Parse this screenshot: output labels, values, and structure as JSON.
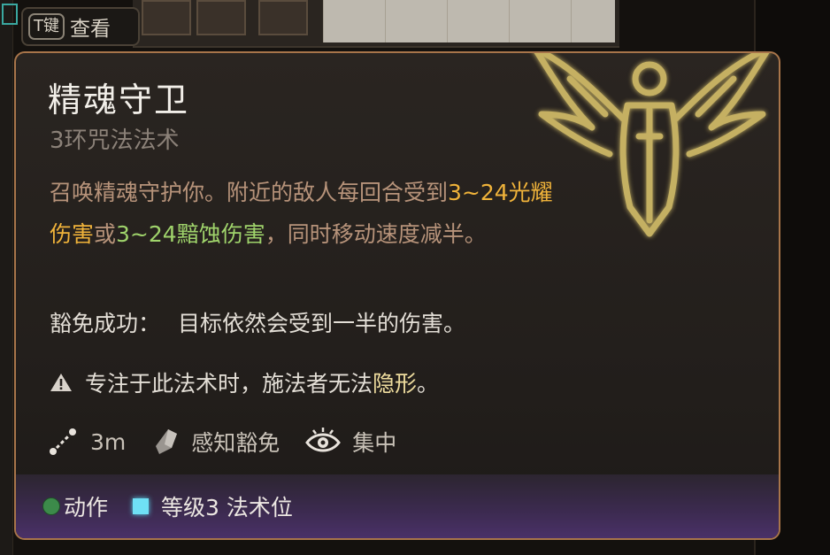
{
  "key_hint": {
    "key": "T键",
    "label": "查看"
  },
  "spell": {
    "title": "精魂守卫",
    "subtitle": "3环咒法法术",
    "description": {
      "part1": "召唤精魂守护你。附近的敌人每回合受到",
      "radiant_damage": "3~24光耀伤害",
      "conj": "或",
      "necrotic_damage": "3~24黯蚀伤害",
      "part2": "，同时移动速度",
      "halved": "减半",
      "end": "。"
    },
    "save": {
      "label": "豁免成功：",
      "text": "目标依然会受到一半的伤害。"
    },
    "concentration_warning": {
      "text": "专注于此法术时，施法者无法",
      "invisible": "隐形",
      "end": "。"
    },
    "properties": {
      "range": "3m",
      "save_type": "感知豁免",
      "concentration": "集中"
    },
    "cost": {
      "action": "动作",
      "spell_slot": "等级3 法术位"
    }
  },
  "colors": {
    "border": "#a8754a",
    "radiant": "#f0b33a",
    "necrotic": "#9fd36b",
    "emblem": "#d6c06a",
    "action_dot": "#3c8a4a",
    "slot_square": "#6fe0f5"
  },
  "icons": {
    "emblem": "winged-guardian-icon",
    "warning": "warning-icon",
    "range": "range-icon",
    "save": "shield-icon",
    "concentration": "eye-icon"
  }
}
